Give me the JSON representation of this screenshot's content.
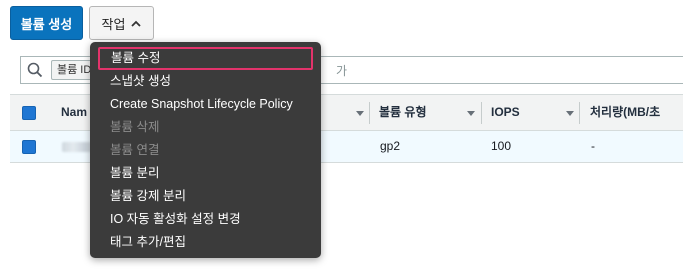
{
  "toolbar": {
    "create_volume_label": "볼륨 생성",
    "actions_label": "작업"
  },
  "search": {
    "filter_token": "볼륨 ID",
    "placeholder_tail": "가"
  },
  "table": {
    "headers": [
      "Nam",
      "볼륨 유형",
      "IOPS",
      "처리량(MB/초"
    ],
    "rows": [
      {
        "name": "",
        "volume_type": "gp2",
        "iops": "100",
        "throughput": "-"
      }
    ]
  },
  "menu": {
    "items": [
      {
        "label": "볼륨 수정",
        "enabled": true,
        "highlighted": true
      },
      {
        "label": "스냅샷 생성",
        "enabled": true
      },
      {
        "label": "Create Snapshot Lifecycle Policy",
        "enabled": true
      },
      {
        "label": "볼륨 삭제",
        "enabled": false
      },
      {
        "label": "볼륨 연결",
        "enabled": false
      },
      {
        "label": "볼륨 분리",
        "enabled": true
      },
      {
        "label": "볼륨 강제 분리",
        "enabled": true
      },
      {
        "label": "IO 자동 활성화 설정 변경",
        "enabled": true
      },
      {
        "label": "태그 추가/편집",
        "enabled": true
      }
    ]
  },
  "colors": {
    "primary": "#0a73bd",
    "highlight_border": "#e2336b",
    "menu_bg": "#3b3b3b",
    "selected_row_bg": "#f1faff"
  },
  "icons": [
    "search-icon",
    "chevron-up-icon",
    "sort-caret-icon"
  ]
}
